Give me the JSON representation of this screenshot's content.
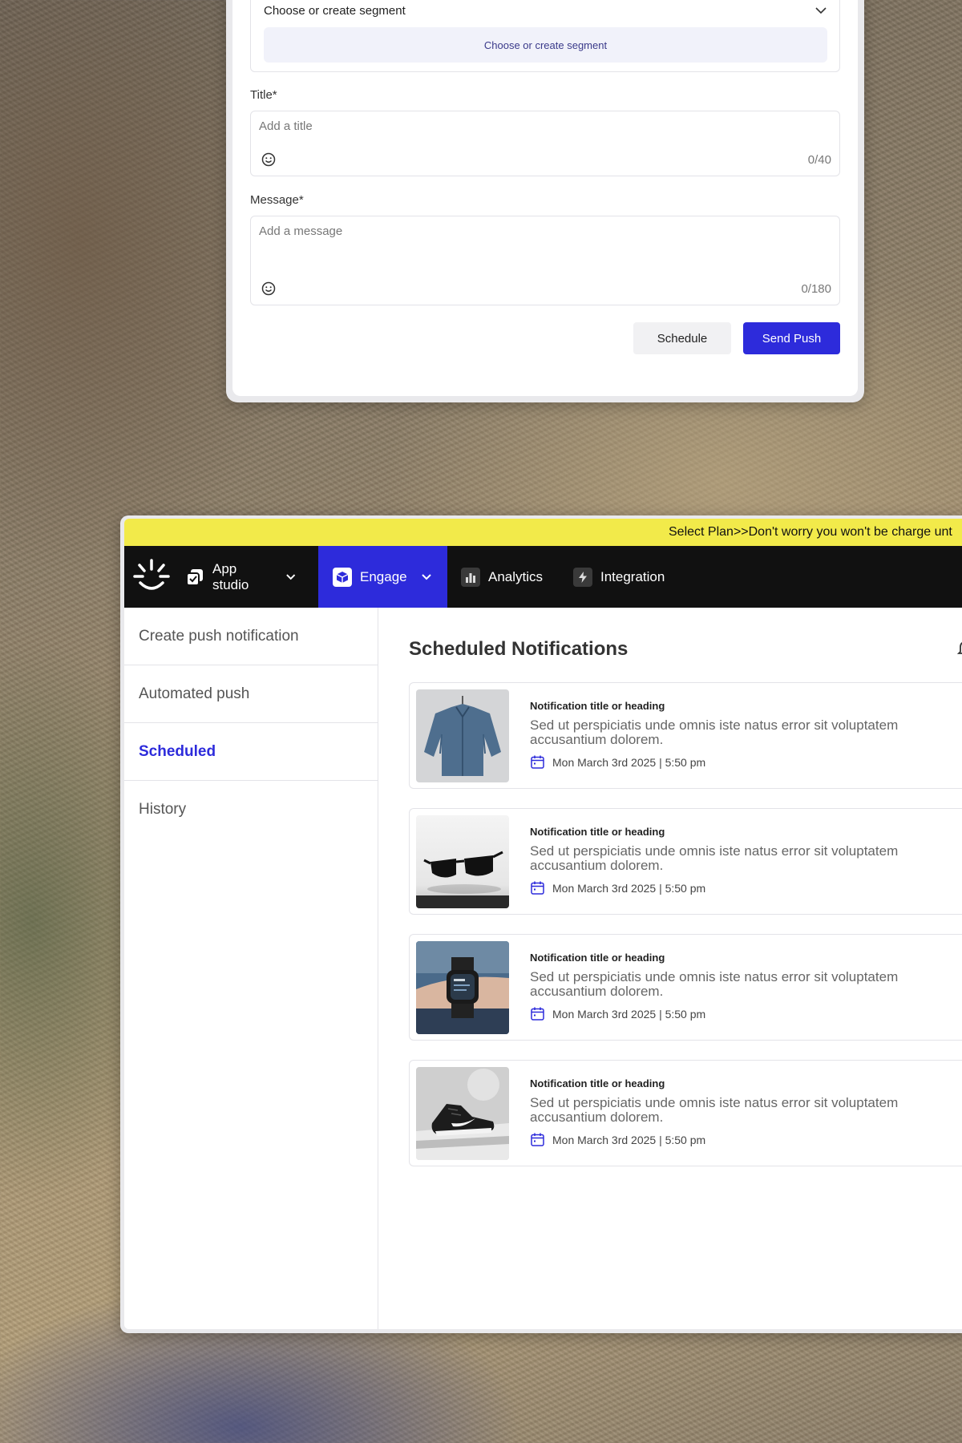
{
  "form": {
    "segment_label": "Choose or create segment",
    "segment_button": "Choose or create segment",
    "title_label": "Title*",
    "title_placeholder": "Add a title",
    "title_counter": "0/40",
    "message_label": "Message*",
    "message_placeholder": "Add a message",
    "message_counter": "0/180",
    "schedule_label": "Schedule",
    "send_label": "Send Push"
  },
  "banner": {
    "link": "Select Plan>>",
    "text": "Don't worry you won't be charge unt"
  },
  "nav": {
    "items": [
      {
        "label": "App studio",
        "icon": "app-studio-icon"
      },
      {
        "label": "Engage",
        "icon": "engage-box-icon"
      },
      {
        "label": "Analytics",
        "icon": "bar-chart-icon"
      },
      {
        "label": "Integration",
        "icon": "lightning-icon"
      }
    ]
  },
  "sidebar": {
    "items": [
      {
        "label": "Create push notification"
      },
      {
        "label": "Automated push"
      },
      {
        "label": "Scheduled"
      },
      {
        "label": "History"
      }
    ]
  },
  "main": {
    "title": "Scheduled Notifications",
    "notifications": [
      {
        "heading": "Notification title or heading",
        "body": "Sed ut perspiciatis unde omnis iste natus error sit voluptatem accusantium dolorem.",
        "date": "Mon March 3rd 2025 | 5:50 pm",
        "image": "denim-shirt"
      },
      {
        "heading": "Notification title or heading",
        "body": "Sed ut perspiciatis unde omnis iste natus error sit voluptatem accusantium dolorem.",
        "date": "Mon March 3rd 2025 | 5:50 pm",
        "image": "sunglasses"
      },
      {
        "heading": "Notification title or heading",
        "body": "Sed ut perspiciatis unde omnis iste natus error sit voluptatem accusantium dolorem.",
        "date": "Mon March 3rd 2025 | 5:50 pm",
        "image": "smartwatch"
      },
      {
        "heading": "Notification title or heading",
        "body": "Sed ut perspiciatis unde omnis iste natus error sit voluptatem accusantium dolorem.",
        "date": "Mon March 3rd 2025 | 5:50 pm",
        "image": "sneaker"
      }
    ]
  },
  "colors": {
    "accent": "#2d2bdb",
    "banner": "#f2ea4a",
    "nav_bg": "#111111"
  }
}
